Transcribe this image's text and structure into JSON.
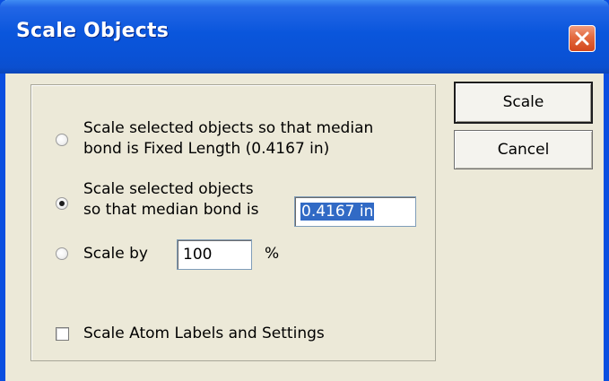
{
  "window": {
    "title": "Scale Objects"
  },
  "options": {
    "fixed_length_line1": "Scale selected objects so that median",
    "fixed_length_line2": "bond is Fixed Length (0.4167 in)",
    "median_line1": "Scale selected objects",
    "median_line2": "so that median bond is",
    "median_value": "0.4167 in",
    "scale_by_label": "Scale by",
    "scale_by_value": "100",
    "percent_label": "%",
    "selected_option": "median_bond_is"
  },
  "checkbox": {
    "label": "Scale Atom Labels and Settings",
    "checked": false
  },
  "buttons": {
    "scale": "Scale",
    "cancel": "Cancel"
  },
  "icons": {
    "close": "close-icon"
  },
  "colors": {
    "titlebar": "#0a56dc",
    "dialog_bg": "#ece9d8",
    "close_button": "#e36a3f",
    "selection": "#316ac5"
  }
}
